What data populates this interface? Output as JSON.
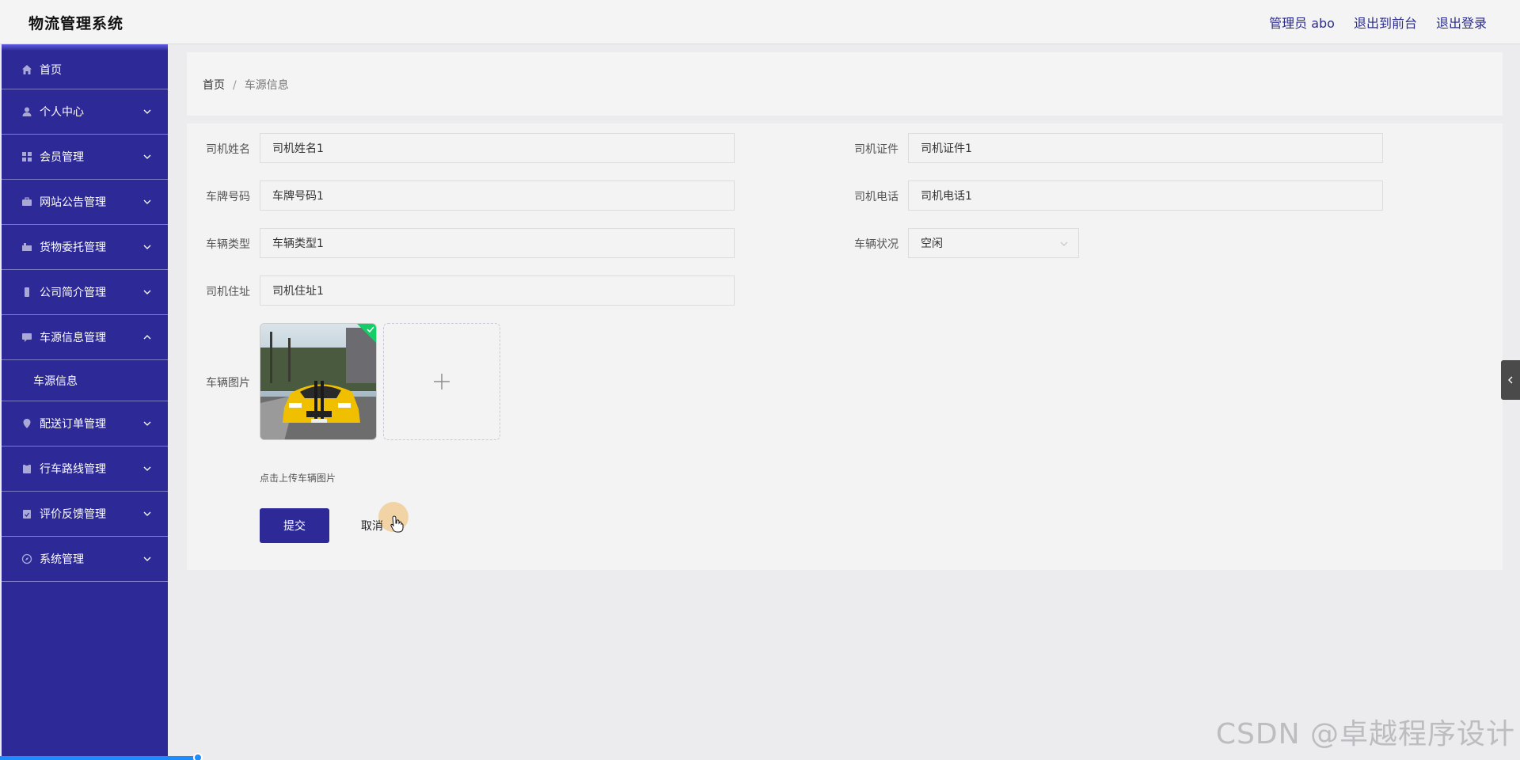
{
  "header": {
    "title": "物流管理系统",
    "user_label": "管理员 abo",
    "front_link": "退出到前台",
    "logout_link": "退出登录"
  },
  "sidebar": {
    "items": [
      {
        "label": "首页",
        "icon": "home-icon"
      },
      {
        "label": "个人中心",
        "icon": "user-icon"
      },
      {
        "label": "会员管理",
        "icon": "grid-icon"
      },
      {
        "label": "网站公告管理",
        "icon": "briefcase-icon"
      },
      {
        "label": "货物委托管理",
        "icon": "truck-icon"
      },
      {
        "label": "公司简介管理",
        "icon": "building-icon"
      },
      {
        "label": "车源信息管理",
        "icon": "message-icon",
        "sub": [
          "车源信息"
        ]
      },
      {
        "label": "配送订单管理",
        "icon": "location-icon"
      },
      {
        "label": "行车路线管理",
        "icon": "clipboard-icon"
      },
      {
        "label": "评价反馈管理",
        "icon": "clipboard-check-icon"
      },
      {
        "label": "系统管理",
        "icon": "compass-icon"
      }
    ]
  },
  "breadcrumb": {
    "home": "首页",
    "separator": "/",
    "current": "车源信息"
  },
  "form": {
    "driver_name": {
      "label": "司机姓名",
      "value": "司机姓名1"
    },
    "driver_license": {
      "label": "司机证件",
      "value": "司机证件1"
    },
    "plate_number": {
      "label": "车牌号码",
      "value": "车牌号码1"
    },
    "driver_phone": {
      "label": "司机电话",
      "value": "司机电话1"
    },
    "vehicle_type": {
      "label": "车辆类型",
      "value": "车辆类型1"
    },
    "vehicle_status": {
      "label": "车辆状况",
      "value": "空闲"
    },
    "driver_address": {
      "label": "司机住址",
      "value": "司机住址1"
    },
    "vehicle_image": {
      "label": "车辆图片",
      "hint": "点击上传车辆图片"
    },
    "submit_label": "提交",
    "cancel_label": "取消"
  },
  "progress": {
    "percent": 13
  },
  "watermark": "CSDN @卓越程序设计",
  "colors": {
    "primary": "#2d2a98",
    "sidebar_divider": "#7e7cc9",
    "link": "#2c2c8c"
  }
}
